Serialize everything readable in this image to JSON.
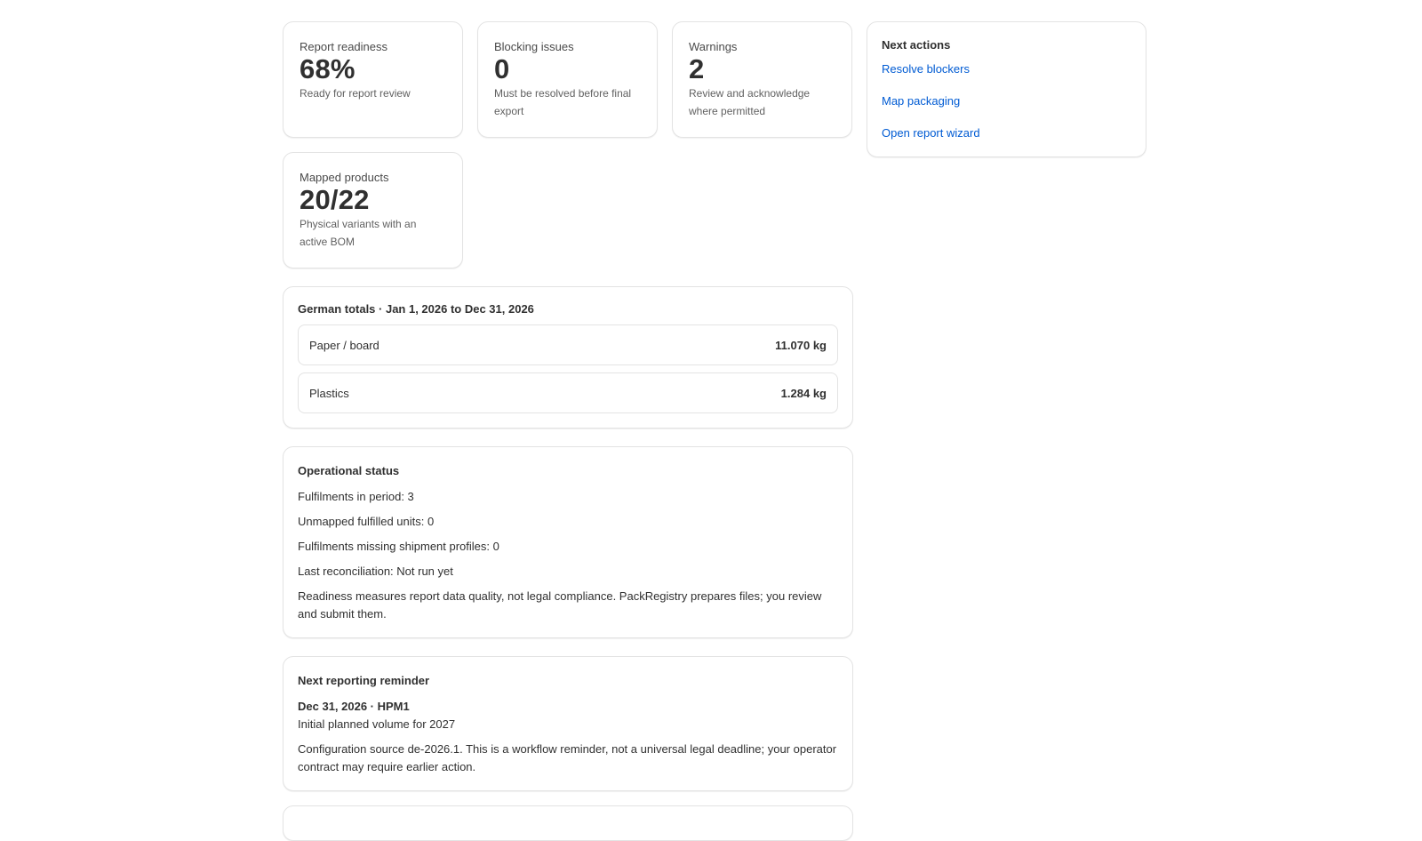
{
  "metrics": [
    {
      "label": "Report readiness",
      "value": "68%",
      "sub": "Ready for report review"
    },
    {
      "label": "Blocking issues",
      "value": "0",
      "sub": "Must be resolved before final export"
    },
    {
      "label": "Warnings",
      "value": "2",
      "sub": "Review and acknowledge where permitted"
    },
    {
      "label": "Mapped products",
      "value": "20/22",
      "sub": "Physical variants with an active BOM"
    }
  ],
  "totals": {
    "title": "German totals · Jan 1, 2026 to Dec 31, 2026",
    "rows": [
      {
        "label": "Paper / board",
        "value": "11.070 kg"
      },
      {
        "label": "Plastics",
        "value": "1.284 kg"
      }
    ]
  },
  "operational": {
    "title": "Operational status",
    "lines": [
      "Fulfilments in period: 3",
      "Unmapped fulfilled units: 0",
      "Fulfilments missing shipment profiles: 0",
      "Last reconciliation: Not run yet"
    ],
    "note": "Readiness measures report data quality, not legal compliance. PackRegistry prepares files; you review and submit them."
  },
  "reminder": {
    "title": "Next reporting reminder",
    "headline": "Dec 31, 2026 · HPM1",
    "subline": "Initial planned volume for 2027",
    "note": "Configuration source de-2026.1. This is a workflow reminder, not a universal legal deadline; your operator contract may require earlier action."
  },
  "next_actions": {
    "title": "Next actions",
    "links": [
      "Resolve blockers",
      "Map packaging",
      "Open report wizard"
    ]
  }
}
